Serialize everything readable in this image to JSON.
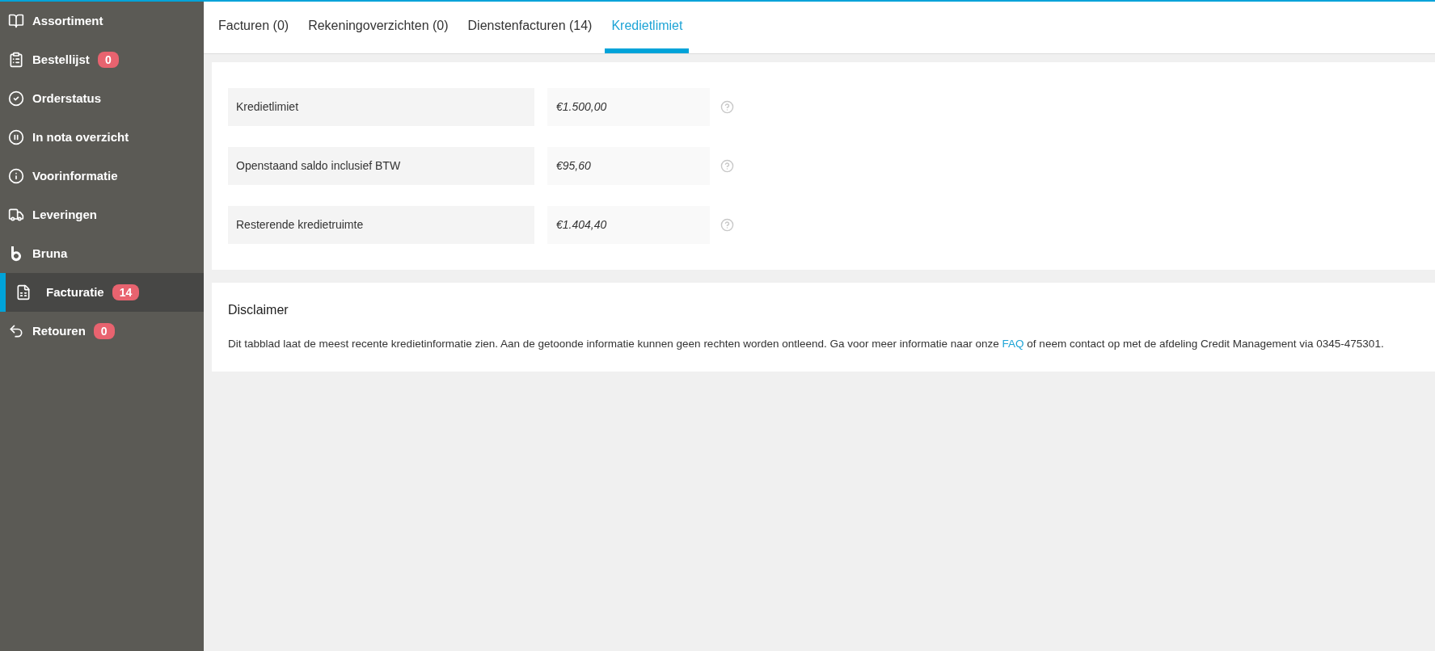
{
  "sidebar": {
    "items": [
      {
        "label": "Assortiment",
        "selected": false
      },
      {
        "label": "Bestellijst",
        "badge": "0",
        "selected": false
      },
      {
        "label": "Orderstatus",
        "selected": false
      },
      {
        "label": "In nota overzicht",
        "selected": false
      },
      {
        "label": "Voorinformatie",
        "selected": false
      },
      {
        "label": "Leveringen",
        "selected": false
      },
      {
        "label": "Bruna",
        "selected": false
      },
      {
        "label": "Facturatie",
        "badge": "14",
        "selected": true
      },
      {
        "label": "Retouren",
        "badge": "0",
        "selected": false
      }
    ]
  },
  "tabs": [
    {
      "label": "Facturen (0)",
      "selected": false
    },
    {
      "label": "Rekeningoverzichten (0)",
      "selected": false
    },
    {
      "label": "Dienstenfacturen (14)",
      "selected": false
    },
    {
      "label": "Kredietlimiet",
      "selected": true
    }
  ],
  "credit_rows": [
    {
      "label": "Kredietlimiet",
      "value": "€1.500,00"
    },
    {
      "label": "Openstaand saldo inclusief BTW",
      "value": "€95,60"
    },
    {
      "label": "Resterende kredietruimte",
      "value": "€1.404,40"
    }
  ],
  "disclaimer": {
    "title": "Disclaimer",
    "text_before": "Dit tabblad laat de meest recente kredietinformatie zien. Aan de getoonde informatie kunnen geen rechten worden ontleend. Ga voor meer informatie naar onze ",
    "link": "FAQ",
    "text_after": " of neem contact op met de afdeling Credit Management via 0345-475301."
  }
}
